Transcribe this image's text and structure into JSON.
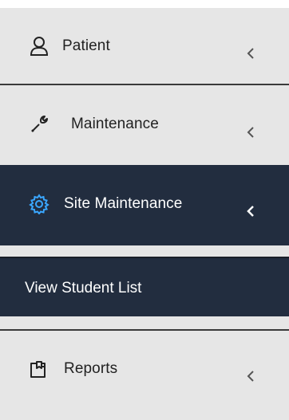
{
  "sidebar": {
    "items": [
      {
        "label": "Patient",
        "icon": "user-icon"
      },
      {
        "label": "Maintenance",
        "icon": "wrench-icon"
      },
      {
        "label": "Site Maintenance",
        "icon": "gear-icon",
        "active": true,
        "expanded": true,
        "children": [
          {
            "label": "View Student List"
          }
        ]
      },
      {
        "label": "Reports",
        "icon": "report-icon"
      }
    ]
  },
  "colors": {
    "menu_bg": "#e6e6e6",
    "active_bg": "#222d3f",
    "accent_icon": "#3aa7ff",
    "divider": "#3a3a3a"
  }
}
